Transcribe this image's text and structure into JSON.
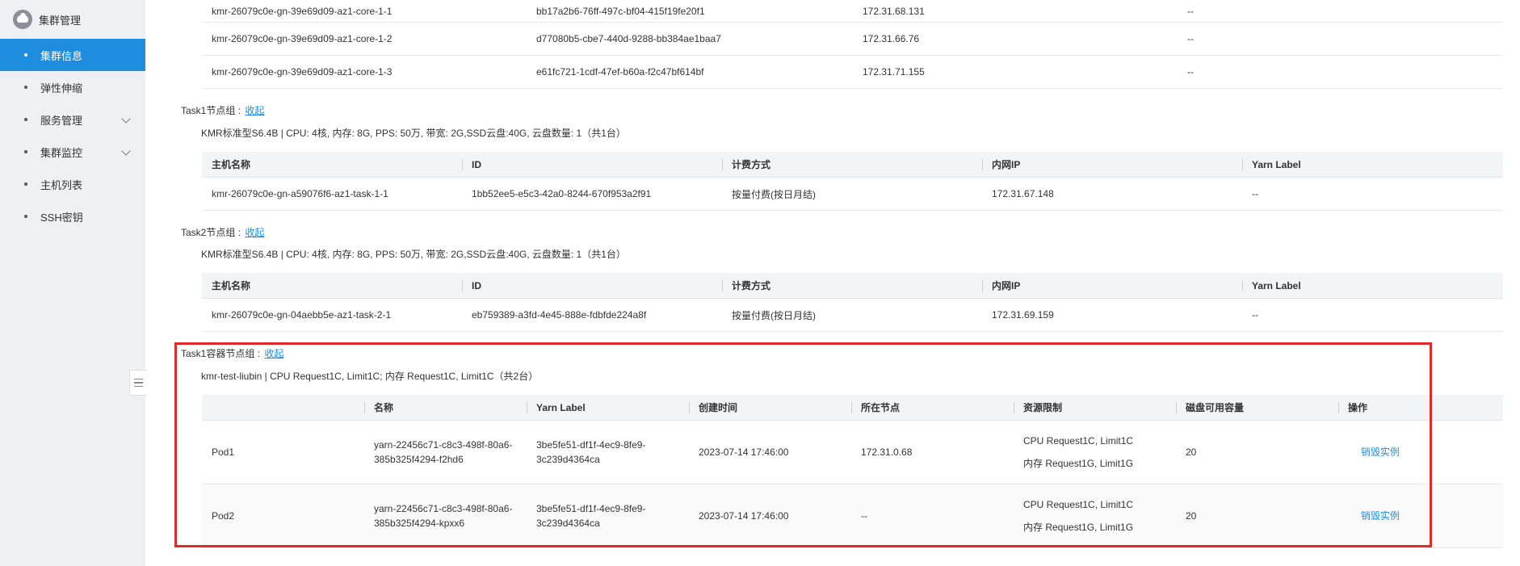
{
  "sidebar": {
    "title": "集群管理",
    "items": [
      {
        "label": "集群信息",
        "active": true,
        "expandable": false
      },
      {
        "label": "弹性伸缩",
        "active": false,
        "expandable": false
      },
      {
        "label": "服务管理",
        "active": false,
        "expandable": true
      },
      {
        "label": "集群监控",
        "active": false,
        "expandable": true
      },
      {
        "label": "主机列表",
        "active": false,
        "expandable": false
      },
      {
        "label": "SSH密钥",
        "active": false,
        "expandable": false
      }
    ]
  },
  "core_rows": [
    [
      "kmr-26079c0e-gn-39e69d09-az1-core-1-1",
      "bb17a2b6-76ff-497c-bf04-415f19fe20f1",
      "172.31.68.131",
      "--"
    ],
    [
      "kmr-26079c0e-gn-39e69d09-az1-core-1-2",
      "d77080b5-cbe7-440d-9288-bb384ae1baa7",
      "172.31.66.76",
      "--"
    ],
    [
      "kmr-26079c0e-gn-39e69d09-az1-core-1-3",
      "e61fc721-1cdf-47ef-b60a-f2c47bf614bf",
      "172.31.71.155",
      "--"
    ]
  ],
  "node_table_headers": [
    "主机名称",
    "ID",
    "计费方式",
    "内网IP",
    "Yarn Label"
  ],
  "task1": {
    "title": "Task1节点组 :",
    "collapse_label": "收起",
    "spec": "KMR标准型S6.4B | CPU: 4核, 内存: 8G, PPS: 50万, 带宽: 2G,SSD云盘:40G, 云盘数量: 1（共1台）",
    "row": [
      "kmr-26079c0e-gn-a59076f6-az1-task-1-1",
      "1bb52ee5-e5c3-42a0-8244-670f953a2f91",
      "按量付费(按日月结)",
      "172.31.67.148",
      "--"
    ]
  },
  "task2": {
    "title": "Task2节点组 :",
    "collapse_label": "收起",
    "spec": "KMR标准型S6.4B | CPU: 4核, 内存: 8G, PPS: 50万, 带宽: 2G,SSD云盘:40G, 云盘数量: 1（共1台）",
    "row": [
      "kmr-26079c0e-gn-04aebb5e-az1-task-2-1",
      "eb759389-a3fd-4e45-888e-fdbfde224a8f",
      "按量付费(按日月结)",
      "172.31.69.159",
      "--"
    ]
  },
  "container_group": {
    "title": "Task1容器节点组 :",
    "collapse_label": "收起",
    "spec": "kmr-test-liubin | CPU Request1C, Limit1C; 内存 Request1C, Limit1C（共2台）",
    "headers": [
      "",
      "名称",
      "Yarn Label",
      "创建时间",
      "所在节点",
      "资源限制",
      "磁盘可用容量",
      "操作"
    ],
    "pods": [
      {
        "pod": "Pod1",
        "name_line1": "yarn-22456c71-c8c3-498f-80a6-",
        "name_line2": "385b325f4294-f2hd6",
        "label_line1": "3be5fe51-df1f-4ec9-8fe9-",
        "label_line2": "3c239d4364ca",
        "created": "2023-07-14 17:46:00",
        "node": "172.31.0.68",
        "cpu_limit": "CPU Request1C, Limit1C",
        "mem_limit": "内存 Request1G, Limit1G",
        "disk": "20",
        "action": "销毁实例"
      },
      {
        "pod": "Pod2",
        "name_line1": "yarn-22456c71-c8c3-498f-80a6-",
        "name_line2": "385b325f4294-kpxx6",
        "label_line1": "3be5fe51-df1f-4ec9-8fe9-",
        "label_line2": "3c239d4364ca",
        "created": "2023-07-14 17:46:00",
        "node": "--",
        "cpu_limit": "CPU Request1C, Limit1C",
        "mem_limit": "内存 Request1G, Limit1G",
        "disk": "20",
        "action": "销毁实例"
      }
    ]
  },
  "colors": {
    "accent": "#1e8de0",
    "highlight": "#e02a2a",
    "sidebar_bg": "#eef0f3"
  }
}
